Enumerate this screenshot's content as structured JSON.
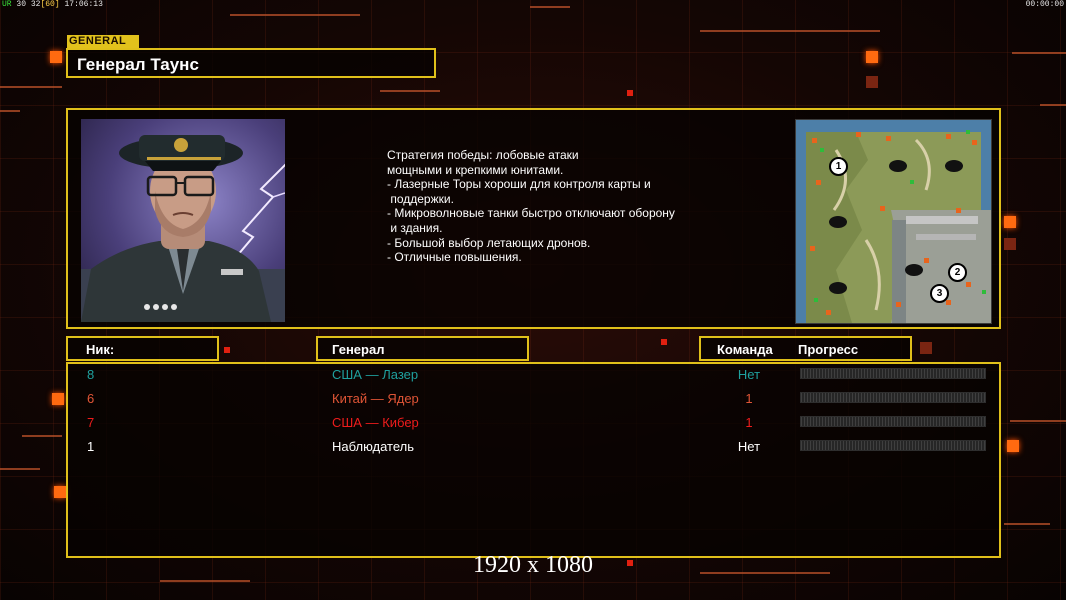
{
  "debug": {
    "label": "UR",
    "a": "30",
    "b": "32",
    "c": "[60]",
    "clock": "17:06:13",
    "timer": "00:00:00"
  },
  "general": {
    "tag": "GENERAL",
    "name": "Генерал Таунс",
    "description": [
      "Стратегия победы: лобовые атаки",
      "мощными и крепкими юнитами.",
      "",
      "- Лазерные Торы хороши для контроля карты и",
      " поддержки.",
      "- Микроволновые танки быстро отключают оборону",
      " и здания.",
      "",
      "- Большой выбор летающих дронов.",
      "- Отличные повышения."
    ]
  },
  "minimap": {
    "slots": [
      "1",
      "2",
      "3"
    ]
  },
  "table": {
    "headers": {
      "nick": "Ник:",
      "general": "Генерал",
      "team": "Команда",
      "progress": "Прогресс"
    },
    "rows": [
      {
        "nick": "8",
        "general": "США — Лазер",
        "team": "Нет",
        "color": "#1fa09e"
      },
      {
        "nick": "6",
        "general": "Китай — Ядер",
        "team": "1",
        "color": "#e05536"
      },
      {
        "nick": "7",
        "general": "США — Кибер",
        "team": "1",
        "color": "#ee1c1c"
      },
      {
        "nick": "1",
        "general": "Наблюдатель",
        "team": "Нет",
        "color": "#ffffff"
      }
    ]
  },
  "resolution": "1920 x 1080",
  "colors": {
    "frame": "#e0c01a",
    "accent": "#ff6a10"
  }
}
